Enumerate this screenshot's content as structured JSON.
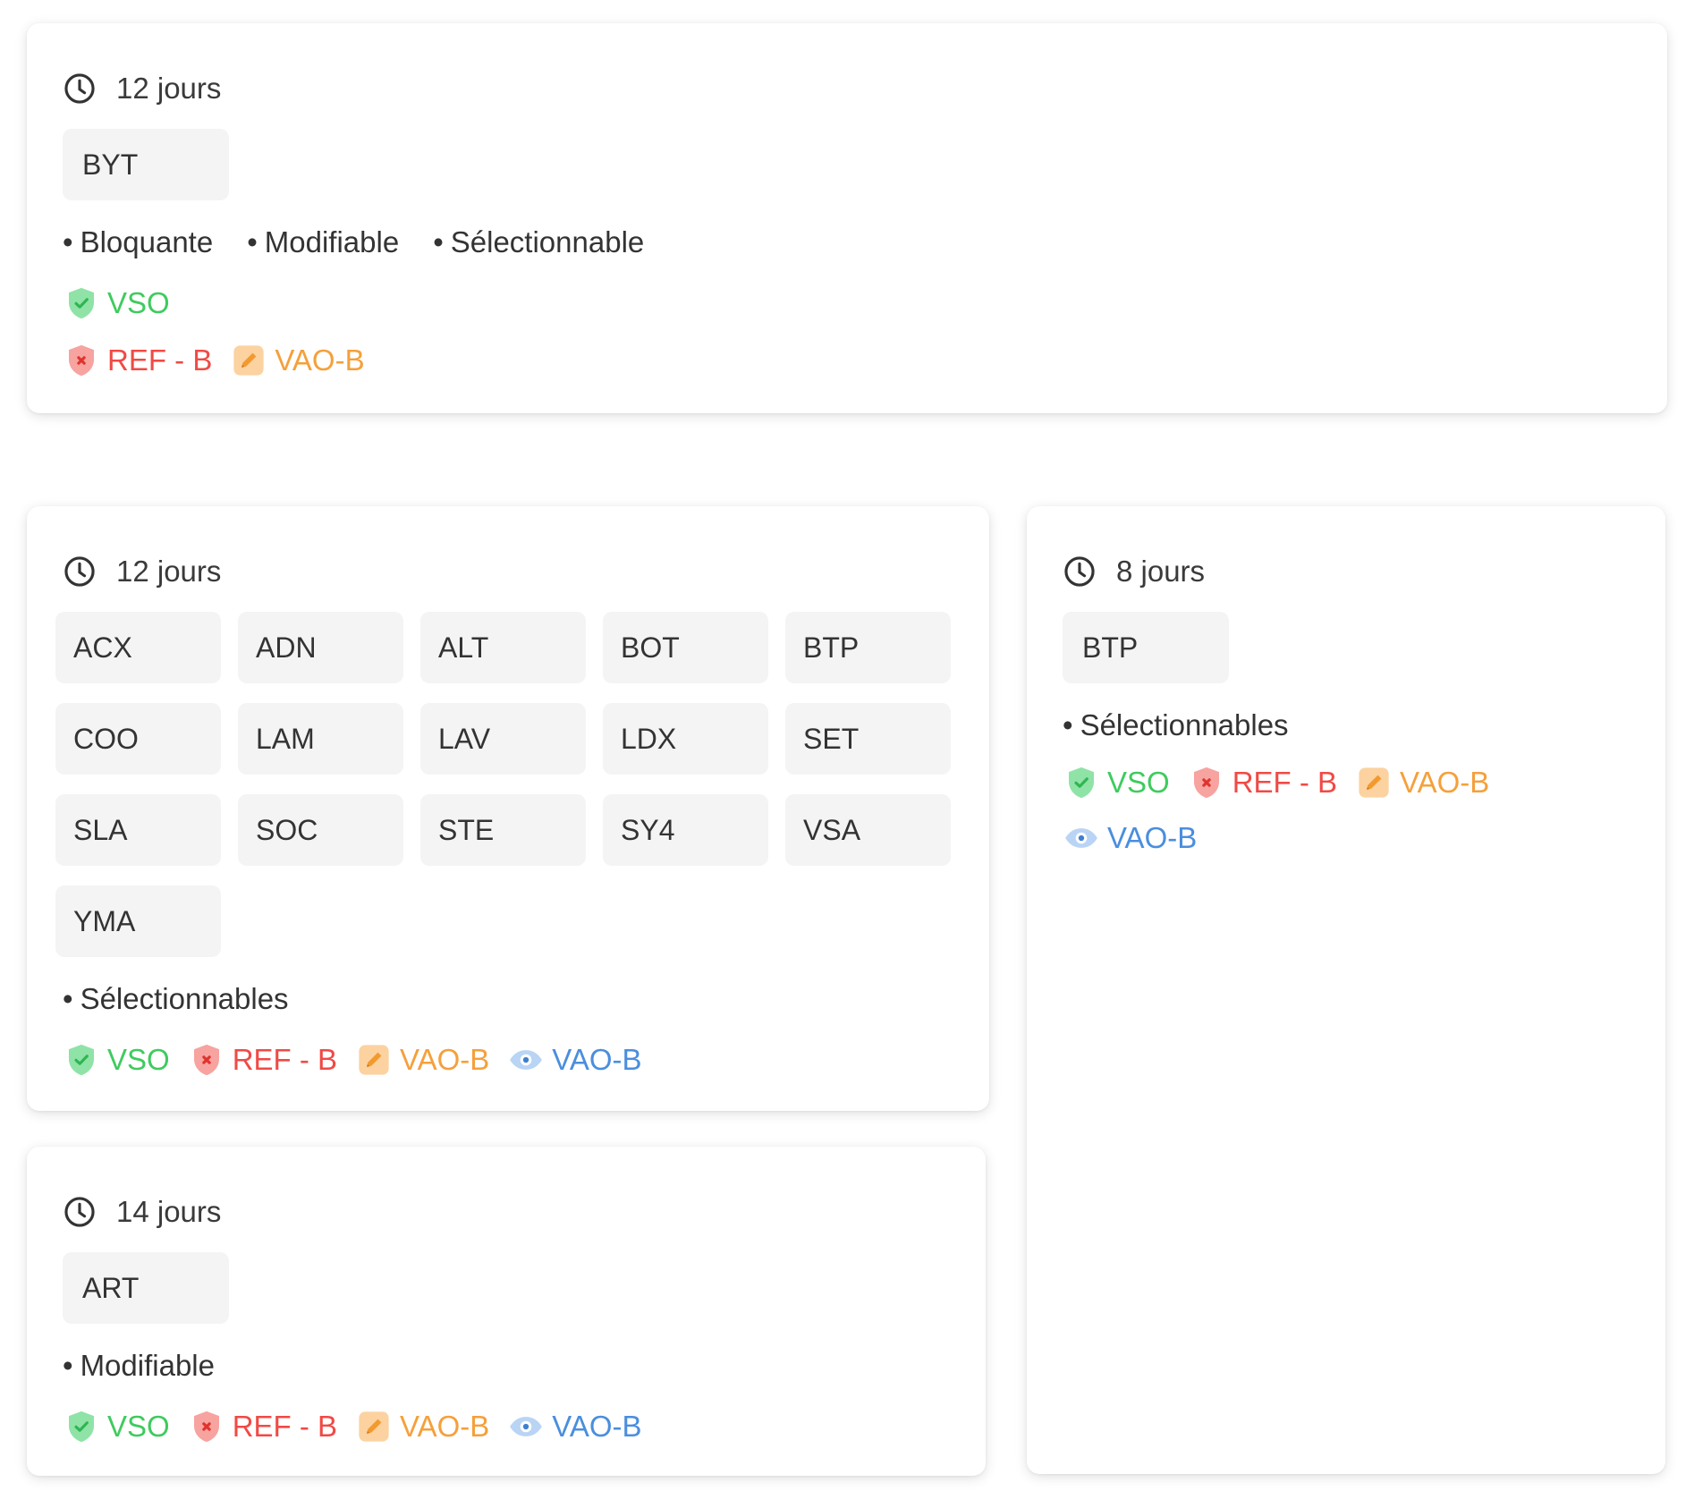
{
  "cards": [
    {
      "duration": "12 jours",
      "chips": [
        "BYT"
      ],
      "properties": [
        "Bloquante",
        "Modifiable",
        "Sélectionnable"
      ],
      "status_rows": [
        [
          {
            "label": "VSO",
            "icon": "shield-check-icon",
            "color": "#3ecb5e"
          }
        ],
        [
          {
            "label": "REF - B",
            "icon": "shield-x-icon",
            "color": "#f04a45"
          },
          {
            "label": "VAO-B",
            "icon": "pencil-icon",
            "color": "#f5a03b"
          }
        ]
      ]
    },
    {
      "duration": "12 jours",
      "chips": [
        "ACX",
        "ADN",
        "ALT",
        "BOT",
        "BTP",
        "COO",
        "LAM",
        "LAV",
        "LDX",
        "SET",
        "SLA",
        "SOC",
        "STE",
        "SY4",
        "VSA",
        "YMA"
      ],
      "properties": [
        "Sélectionnables"
      ],
      "status_rows": [
        [
          {
            "label": "VSO",
            "icon": "shield-check-icon",
            "color": "#3ecb5e"
          },
          {
            "label": "REF - B",
            "icon": "shield-x-icon",
            "color": "#f04a45"
          },
          {
            "label": "VAO-B",
            "icon": "pencil-icon",
            "color": "#f5a03b"
          },
          {
            "label": "VAO-B",
            "icon": "eye-icon",
            "color": "#4a8ede"
          }
        ]
      ]
    },
    {
      "duration": "8 jours",
      "chips": [
        "BTP"
      ],
      "properties": [
        "Sélectionnables"
      ],
      "status_rows": [
        [
          {
            "label": "VSO",
            "icon": "shield-check-icon",
            "color": "#3ecb5e"
          },
          {
            "label": "REF - B",
            "icon": "shield-x-icon",
            "color": "#f04a45"
          },
          {
            "label": "VAO-B",
            "icon": "pencil-icon",
            "color": "#f5a03b"
          },
          {
            "label": "VAO-B",
            "icon": "eye-icon",
            "color": "#4a8ede"
          }
        ]
      ]
    },
    {
      "duration": "14 jours",
      "chips": [
        "ART"
      ],
      "properties": [
        "Modifiable"
      ],
      "status_rows": [
        [
          {
            "label": "VSO",
            "icon": "shield-check-icon",
            "color": "#3ecb5e"
          },
          {
            "label": "REF - B",
            "icon": "shield-x-icon",
            "color": "#f04a45"
          },
          {
            "label": "VAO-B",
            "icon": "pencil-icon",
            "color": "#f5a03b"
          },
          {
            "label": "VAO-B",
            "icon": "eye-icon",
            "color": "#4a8ede"
          }
        ]
      ]
    }
  ]
}
